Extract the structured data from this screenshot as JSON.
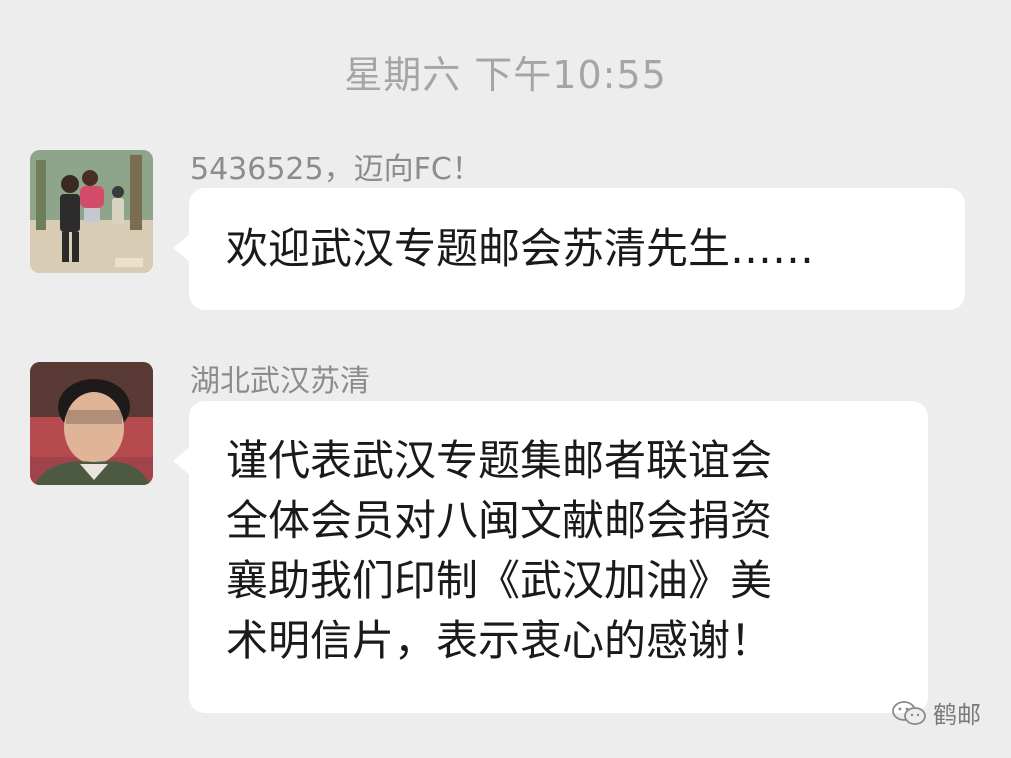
{
  "timestamp": "星期六 下午10:55",
  "messages": [
    {
      "sender": "5436525，迈向FC！",
      "lines": [
        "欢迎武汉专题邮会苏清先生……"
      ]
    },
    {
      "sender": "湖北武汉苏清",
      "lines": [
        "谨代表武汉专题集邮者联谊会",
        "全体会员对八闽文献邮会捐资",
        "襄助我们印制《武汉加油》美",
        "术明信片，表示衷心的感谢！"
      ]
    }
  ],
  "watermark": {
    "icon": "wechat-icon",
    "text": "鹤邮"
  },
  "colors": {
    "background": "#ededed",
    "bubble": "#ffffff",
    "meta_text": "#8c8c8c"
  }
}
